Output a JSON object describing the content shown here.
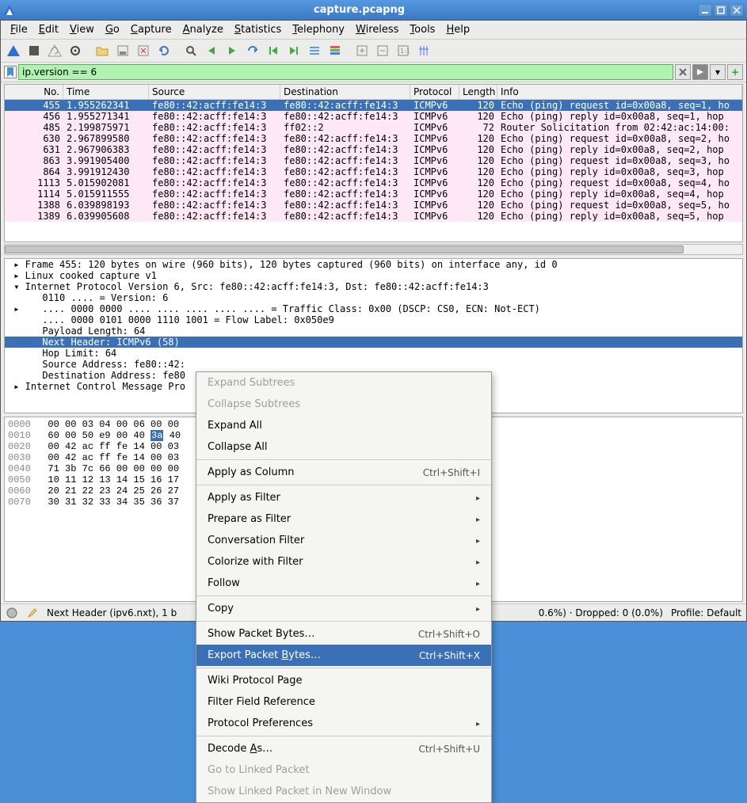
{
  "titlebar": {
    "title": "capture.pcapng"
  },
  "menubar": [
    "File",
    "Edit",
    "View",
    "Go",
    "Capture",
    "Analyze",
    "Statistics",
    "Telephony",
    "Wireless",
    "Tools",
    "Help"
  ],
  "filter": {
    "value": "ip.version == 6"
  },
  "columns": {
    "no": "No.",
    "time": "Time",
    "src": "Source",
    "dst": "Destination",
    "proto": "Protocol",
    "len": "Length",
    "info": "Info"
  },
  "packets": [
    {
      "no": "455",
      "time": "1.955262341",
      "src": "fe80::42:acff:fe14:3",
      "dst": "fe80::42:acff:fe14:3",
      "proto": "ICMPv6",
      "len": "120",
      "info": "Echo (ping) request id=0x00a8, seq=1, ho",
      "sel": true
    },
    {
      "no": "456",
      "time": "1.955271341",
      "src": "fe80::42:acff:fe14:3",
      "dst": "fe80::42:acff:fe14:3",
      "proto": "ICMPv6",
      "len": "120",
      "info": "Echo (ping) reply id=0x00a8, seq=1, hop"
    },
    {
      "no": "485",
      "time": "2.199875971",
      "src": "fe80::42:acff:fe14:3",
      "dst": "ff02::2",
      "proto": "ICMPv6",
      "len": "72",
      "info": "Router Solicitation from 02:42:ac:14:00:"
    },
    {
      "no": "630",
      "time": "2.967899580",
      "src": "fe80::42:acff:fe14:3",
      "dst": "fe80::42:acff:fe14:3",
      "proto": "ICMPv6",
      "len": "120",
      "info": "Echo (ping) request id=0x00a8, seq=2, ho"
    },
    {
      "no": "631",
      "time": "2.967906383",
      "src": "fe80::42:acff:fe14:3",
      "dst": "fe80::42:acff:fe14:3",
      "proto": "ICMPv6",
      "len": "120",
      "info": "Echo (ping) reply id=0x00a8, seq=2, hop"
    },
    {
      "no": "863",
      "time": "3.991905400",
      "src": "fe80::42:acff:fe14:3",
      "dst": "fe80::42:acff:fe14:3",
      "proto": "ICMPv6",
      "len": "120",
      "info": "Echo (ping) request id=0x00a8, seq=3, ho"
    },
    {
      "no": "864",
      "time": "3.991912430",
      "src": "fe80::42:acff:fe14:3",
      "dst": "fe80::42:acff:fe14:3",
      "proto": "ICMPv6",
      "len": "120",
      "info": "Echo (ping) reply id=0x00a8, seq=3, hop"
    },
    {
      "no": "1113",
      "time": "5.015902081",
      "src": "fe80::42:acff:fe14:3",
      "dst": "fe80::42:acff:fe14:3",
      "proto": "ICMPv6",
      "len": "120",
      "info": "Echo (ping) request id=0x00a8, seq=4, ho"
    },
    {
      "no": "1114",
      "time": "5.015911555",
      "src": "fe80::42:acff:fe14:3",
      "dst": "fe80::42:acff:fe14:3",
      "proto": "ICMPv6",
      "len": "120",
      "info": "Echo (ping) reply id=0x00a8, seq=4, hop"
    },
    {
      "no": "1388",
      "time": "6.039898193",
      "src": "fe80::42:acff:fe14:3",
      "dst": "fe80::42:acff:fe14:3",
      "proto": "ICMPv6",
      "len": "120",
      "info": "Echo (ping) request id=0x00a8, seq=5, ho"
    },
    {
      "no": "1389",
      "time": "6.039905608",
      "src": "fe80::42:acff:fe14:3",
      "dst": "fe80::42:acff:fe14:3",
      "proto": "ICMPv6",
      "len": "120",
      "info": "Echo (ping) reply id=0x00a8, seq=5, hop"
    }
  ],
  "details": [
    {
      "t": "▸",
      "pad": "",
      "txt": "Frame 455: 120 bytes on wire (960 bits), 120 bytes captured (960 bits) on interface any, id 0"
    },
    {
      "t": "▸",
      "pad": "",
      "txt": "Linux cooked capture v1"
    },
    {
      "t": "▾",
      "pad": "",
      "txt": "Internet Protocol Version 6, Src: fe80::42:acff:fe14:3, Dst: fe80::42:acff:fe14:3"
    },
    {
      "t": " ",
      "pad": "   ",
      "txt": "0110 .... = Version: 6"
    },
    {
      "t": "▸",
      "pad": "   ",
      "txt": ".... 0000 0000 .... .... .... .... .... = Traffic Class: 0x00 (DSCP: CS0, ECN: Not-ECT)"
    },
    {
      "t": " ",
      "pad": "   ",
      "txt": ".... 0000 0101 0000 1110 1001 = Flow Label: 0x050e9"
    },
    {
      "t": " ",
      "pad": "   ",
      "txt": "Payload Length: 64"
    },
    {
      "t": " ",
      "pad": "   ",
      "txt": "Next Header: ICMPv6 (58)",
      "sel": true
    },
    {
      "t": " ",
      "pad": "   ",
      "txt": "Hop Limit: 64"
    },
    {
      "t": " ",
      "pad": "   ",
      "txt": "Source Address: fe80::42:"
    },
    {
      "t": " ",
      "pad": "   ",
      "txt": "Destination Address: fe80"
    },
    {
      "t": "▸",
      "pad": "",
      "txt": "Internet Control Message Pro"
    }
  ],
  "hex_pre": "0000  00 00 03 04 00 06 00 00\n0010  60 00 50 e9 00 40 ",
  "hex_hl": "3a",
  "hex_post": " 40\n0020  00 42 ac ff fe 14 00 03\n0030  00 42 ac ff fe 14 00 03\n0040  71 3b 7c 66 00 00 00 00\n0050  10 11 12 13 14 15 16 17\n0060  20 21 22 23 24 25 26 27\n0070  30 31 32 33 34 35 36 37",
  "status": {
    "field": "Next Header (ipv6.nxt), 1 b",
    "pkts": "0.6%) · Dropped: 0 (0.0%)",
    "profile": "Profile: Default"
  },
  "ctx": [
    {
      "type": "item",
      "label": "Expand Subtrees",
      "disabled": true
    },
    {
      "type": "item",
      "label": "Collapse Subtrees",
      "disabled": true
    },
    {
      "type": "item",
      "label": "Expand All"
    },
    {
      "type": "item",
      "label": "Collapse All"
    },
    {
      "type": "sep"
    },
    {
      "type": "item",
      "label": "Apply as Column",
      "accel": "Ctrl+Shift+I"
    },
    {
      "type": "sep"
    },
    {
      "type": "item",
      "label": "Apply as Filter",
      "sub": true
    },
    {
      "type": "item",
      "label": "Prepare as Filter",
      "sub": true
    },
    {
      "type": "item",
      "label": "Conversation Filter",
      "sub": true
    },
    {
      "type": "item",
      "label": "Colorize with Filter",
      "sub": true
    },
    {
      "type": "item",
      "label": "Follow",
      "sub": true
    },
    {
      "type": "sep"
    },
    {
      "type": "item",
      "label": "Copy",
      "sub": true
    },
    {
      "type": "sep"
    },
    {
      "type": "item",
      "label": "Show Packet Bytes…",
      "accel": "Ctrl+Shift+O"
    },
    {
      "type": "item",
      "label": "Export Packet Bytes…",
      "accel": "Ctrl+Shift+X",
      "sel": true,
      "u": "B"
    },
    {
      "type": "sep"
    },
    {
      "type": "item",
      "label": "Wiki Protocol Page"
    },
    {
      "type": "item",
      "label": "Filter Field Reference"
    },
    {
      "type": "item",
      "label": "Protocol Preferences",
      "sub": true
    },
    {
      "type": "sep"
    },
    {
      "type": "item",
      "label": "Decode As…",
      "accel": "Ctrl+Shift+U",
      "u": "A"
    },
    {
      "type": "item",
      "label": "Go to Linked Packet",
      "disabled": true
    },
    {
      "type": "item",
      "label": "Show Linked Packet in New Window",
      "disabled": true
    }
  ]
}
